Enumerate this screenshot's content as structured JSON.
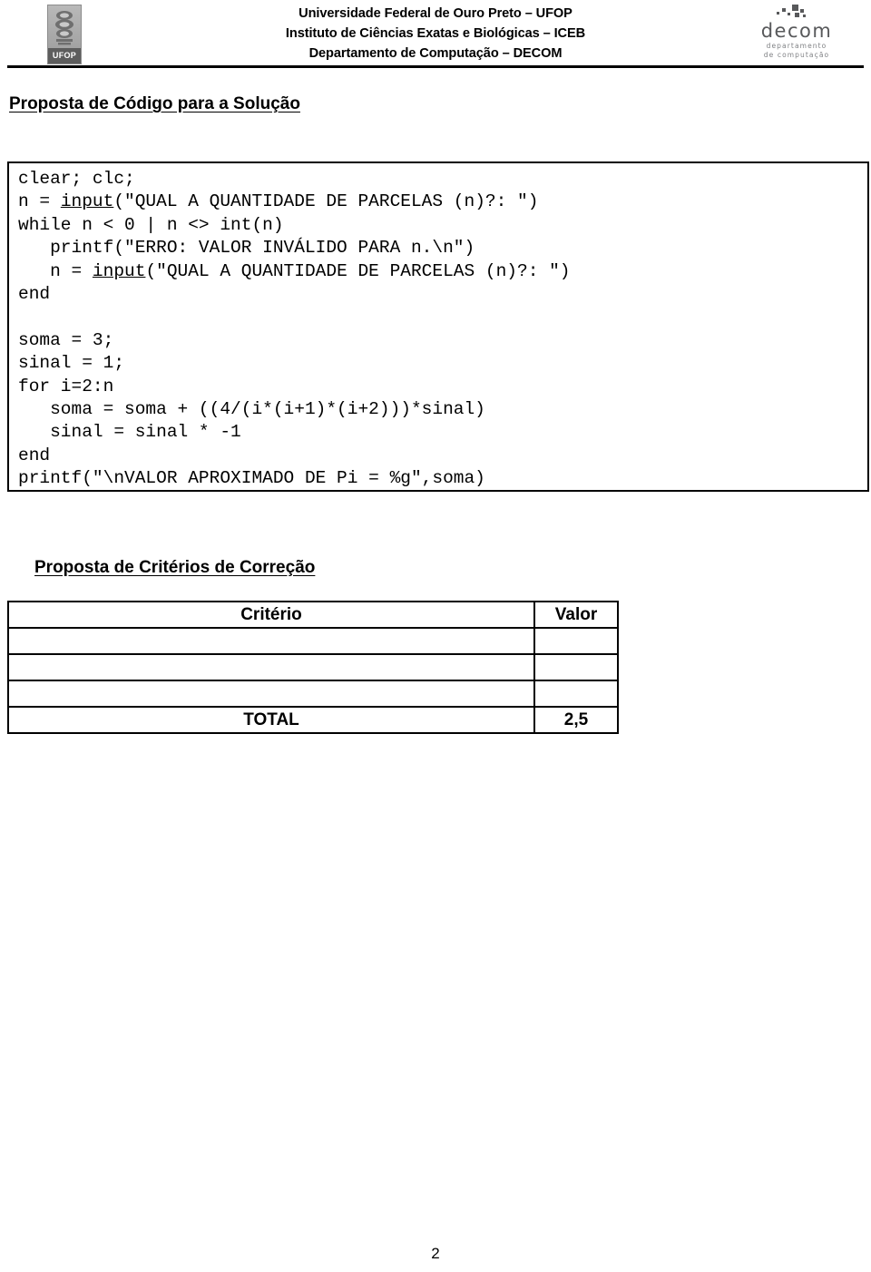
{
  "header": {
    "institution_lines": [
      "Universidade Federal de Ouro Preto – UFOP",
      "Instituto de Ciências Exatas e Biológicas – ICEB",
      "Departamento de Computação – DECOM"
    ],
    "ufop_logo_label": "UFOP",
    "decom_logo_name": "decom",
    "decom_logo_sub_line1": "departamento",
    "decom_logo_sub_line2": "de computação"
  },
  "sections": {
    "code_heading": "Proposta de Código para a Solução",
    "criteria_heading": "Proposta de Critérios de Correção"
  },
  "code": {
    "language": "MATLAB/Octave",
    "lines": [
      "clear; clc;",
      "n = input(\"QUAL A QUANTIDADE DE PARCELAS (n)?: \")",
      "while n < 0 | n <> int(n)",
      "   printf(\"ERRO: VALOR INVÁLIDO PARA n.\\n\")",
      "   n = input(\"QUAL A QUANTIDADE DE PARCELAS (n)?: \")",
      "end",
      "",
      "soma = 3;",
      "sinal = 1;",
      "for i=2:n",
      "   soma = soma + ((4/(i*(i+1)*(i+2)))*sinal)",
      "   sinal = sinal * -1",
      "end",
      "printf(\"\\nVALOR APROXIMADO DE Pi = %g\",soma)"
    ],
    "underlined_tokens": [
      "input"
    ]
  },
  "criteria_table": {
    "headers": [
      "Critério",
      "Valor"
    ],
    "rows": [
      {
        "criterio": "",
        "valor": ""
      },
      {
        "criterio": "",
        "valor": ""
      },
      {
        "criterio": "",
        "valor": ""
      }
    ],
    "total_row": {
      "label": "TOTAL",
      "value": "2,5"
    }
  },
  "footer": {
    "page_number": "2"
  }
}
